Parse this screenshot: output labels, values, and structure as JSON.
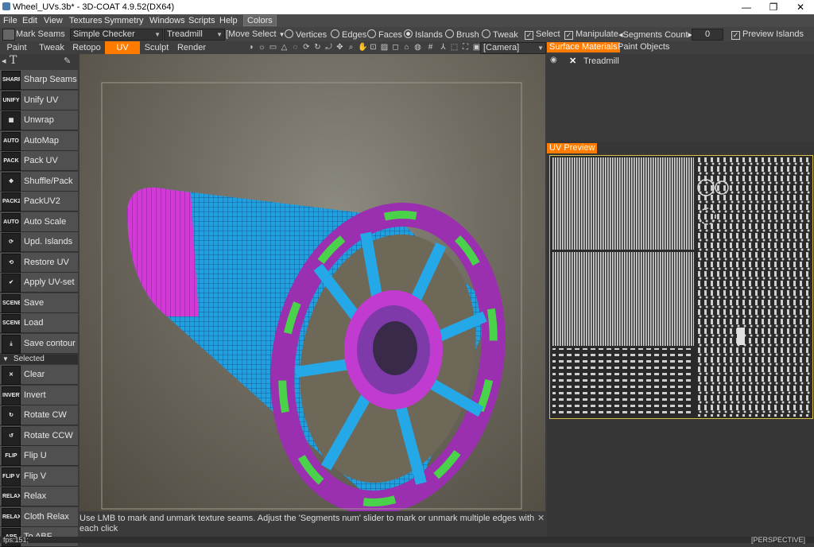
{
  "window": {
    "title": "Wheel_UVs.3b* - 3D-COAT 4.9.52(DX64)",
    "min": "—",
    "max": "❐",
    "close": "✕"
  },
  "menu": [
    "File",
    "Edit",
    "View",
    "Textures",
    "Symmetry",
    "Windows",
    "Scripts",
    "Help",
    "Colors"
  ],
  "toolbar": {
    "mark_seams": "Mark Seams",
    "checker": "Simple Checker",
    "object": "Treadmill",
    "move_select": "[Move Select",
    "vertices": "Vertices",
    "edges": "Edges",
    "faces": "Faces",
    "islands": "Islands",
    "brush": "Brush",
    "tweak": "Tweak",
    "select": "Select",
    "manipulate": "Manipulate",
    "segments_count": "◂Segments Count▸",
    "segments_value": "0",
    "preview_islands": "Preview Islands"
  },
  "tabs": [
    "Paint",
    "Tweak",
    "Retopo",
    "UV",
    "Sculpt",
    "Render"
  ],
  "camera": "[Camera]",
  "tools": [
    {
      "icon": "SHARP",
      "label": "Sharp Seams"
    },
    {
      "icon": "UNIFY",
      "label": "Unify UV"
    },
    {
      "icon": "▦",
      "label": "Unwrap"
    },
    {
      "icon": "AUTO MAP",
      "label": "AutoMap"
    },
    {
      "icon": "PACK",
      "label": "Pack UV"
    },
    {
      "icon": "✥",
      "label": "Shuffle/Pack"
    },
    {
      "icon": "PACK2",
      "label": "PackUV2"
    },
    {
      "icon": "AUTO",
      "label": "Auto Scale"
    },
    {
      "icon": "⟳",
      "label": "Upd. Islands"
    },
    {
      "icon": "⟲",
      "label": "Restore UV"
    },
    {
      "icon": "✔",
      "label": "Apply UV-set"
    },
    {
      "icon": "SCENE",
      "label": "Save"
    },
    {
      "icon": "SCENE",
      "label": "Load"
    },
    {
      "icon": "⤓",
      "label": "Save contour"
    }
  ],
  "selected_header": "Selected",
  "selected_tools": [
    {
      "icon": "✕",
      "label": "Clear"
    },
    {
      "icon": "INVERT",
      "label": "Invert"
    },
    {
      "icon": "↻",
      "label": "Rotate CW"
    },
    {
      "icon": "↺",
      "label": "Rotate CCW"
    },
    {
      "icon": "FLIP U",
      "label": "Flip U"
    },
    {
      "icon": "FLIP V",
      "label": "Flip V"
    },
    {
      "icon": "RELAX",
      "label": "Relax"
    },
    {
      "icon": "RELAX",
      "label": "Cloth Relax"
    },
    {
      "icon": "ABF",
      "label": "To ABF"
    }
  ],
  "right": {
    "tab_surface": "Surface Materials",
    "tab_paint_objects": "Paint Objects",
    "layer_name": "Treadmill",
    "uv_preview": "UV Preview"
  },
  "hint": "Use LMB to mark and unmark texture seams. Adjust the 'Segments num' slider to mark or unmark multiple edges with each click",
  "status": {
    "fps": "fps:151;",
    "view": "[PERSPECTIVE]"
  },
  "colors": {
    "accent": "#ff7b00",
    "panel": "#3a3a3a"
  }
}
